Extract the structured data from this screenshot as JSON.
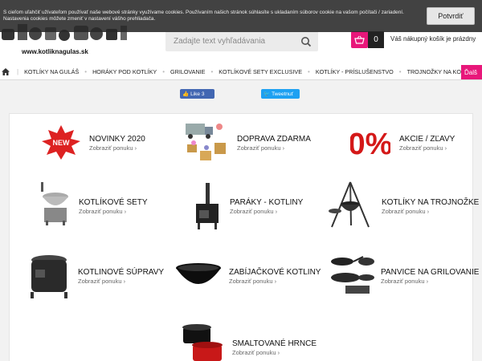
{
  "cookie": {
    "text": "S cieľom uľahčiť užívateľom používať naše webové stránky využívame cookies. Používaním našich stránok súhlasíte s ukladaním súborov cookie na vašom počítači / zariadení. Nastavenia cookies môžete zmeniť v nastavení vášho prehliadača.",
    "button": "Potvrdiť"
  },
  "header": {
    "logo_url": "www.kotliknagulas.sk",
    "search_placeholder": "Zadajte text vyhľadávania",
    "cart_count": "0",
    "cart_text": "Váš nákupný košík je prázdny"
  },
  "nav": {
    "items": [
      "KOTLÍKY NA GULÁŠ",
      "HORÁKY POD KOTLÍKY",
      "GRILOVANIE",
      "KOTLÍKOVÉ SETY EXCLUSIVE",
      "KOTLÍKY - PRÍSLUŠENSTVO",
      "TROJNOŽKY NA KOTLÍKY"
    ],
    "more": "Ďalš"
  },
  "social": {
    "like": "Like 3",
    "tweet": "Tweetnuť"
  },
  "categories": [
    {
      "title": "NOVINKY 2020",
      "link": "Zobraziť ponuku",
      "icon": "new-badge-icon"
    },
    {
      "title": "DOPRAVA ZDARMA",
      "link": "Zobraziť ponuku",
      "icon": "delivery-icon"
    },
    {
      "title": "AKCIE / ZĽAVY",
      "link": "Zobraziť ponuku",
      "icon": "percent-icon"
    },
    {
      "title": "KOTLÍKOVÉ SETY",
      "link": "Zobraziť ponuku",
      "icon": "kettle-set-icon"
    },
    {
      "title": "PARÁKY - KOTLINY",
      "link": "Zobraziť ponuku",
      "icon": "stove-icon"
    },
    {
      "title": "KOTLÍKY NA TROJNOŽKE",
      "link": "Zobraziť ponuku",
      "icon": "tripod-icon"
    },
    {
      "title": "KOTLINOVÉ SÚPRAVY",
      "link": "Zobraziť ponuku",
      "icon": "cauldron-icon"
    },
    {
      "title": "ZABÍJAČKOVÉ KOTLINY",
      "link": "Zobraziť ponuku",
      "icon": "pot-icon"
    },
    {
      "title": "PANVICE NA GRILOVANIE",
      "link": "Zobraziť ponuku",
      "icon": "pan-icon"
    },
    {
      "title": "SMALTOVANÉ HRNCE",
      "link": "Zobraziť ponuku",
      "icon": "enamel-pot-icon"
    }
  ],
  "colors": {
    "accent": "#e8177a",
    "nav_bg": "#ffffff",
    "panel_bg": "#ffffff"
  }
}
